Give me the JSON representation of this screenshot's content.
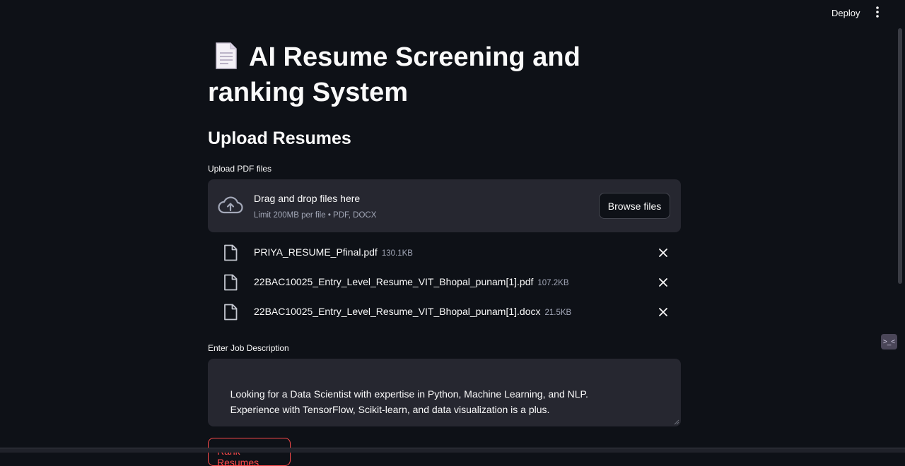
{
  "header": {
    "deploy_label": "Deploy",
    "menu_icon": "kebab-menu-icon"
  },
  "page": {
    "title_emoji": "page-facing-up-icon",
    "title": "AI Resume Screening and ranking System",
    "subtitle": "Upload Resumes"
  },
  "uploader": {
    "label": "Upload PDF files",
    "drop_text": "Drag and drop files here",
    "limit_text": "Limit 200MB per file • PDF, DOCX",
    "browse_label": "Browse files",
    "files": [
      {
        "name": "PRIYA_RESUME_Pfinal.pdf",
        "size": "130.1KB"
      },
      {
        "name": "22BAC10025_Entry_Level_Resume_VIT_Bhopal_punam[1].pdf",
        "size": "107.2KB"
      },
      {
        "name": "22BAC10025_Entry_Level_Resume_VIT_Bhopal_punam[1].docx",
        "size": "21.5KB"
      }
    ]
  },
  "job": {
    "label": "Enter Job Description",
    "value": "Looking for a Data Scientist with expertise in Python, Machine Learning, and NLP.\n    Experience with TensorFlow, Scikit-learn, and data visualization is a plus."
  },
  "actions": {
    "rank_label": "Rank Resumes"
  },
  "colors": {
    "background": "#0e1117",
    "surface": "#262730",
    "accent": "#ff4b4b",
    "muted_text": "#a3a8b8"
  }
}
